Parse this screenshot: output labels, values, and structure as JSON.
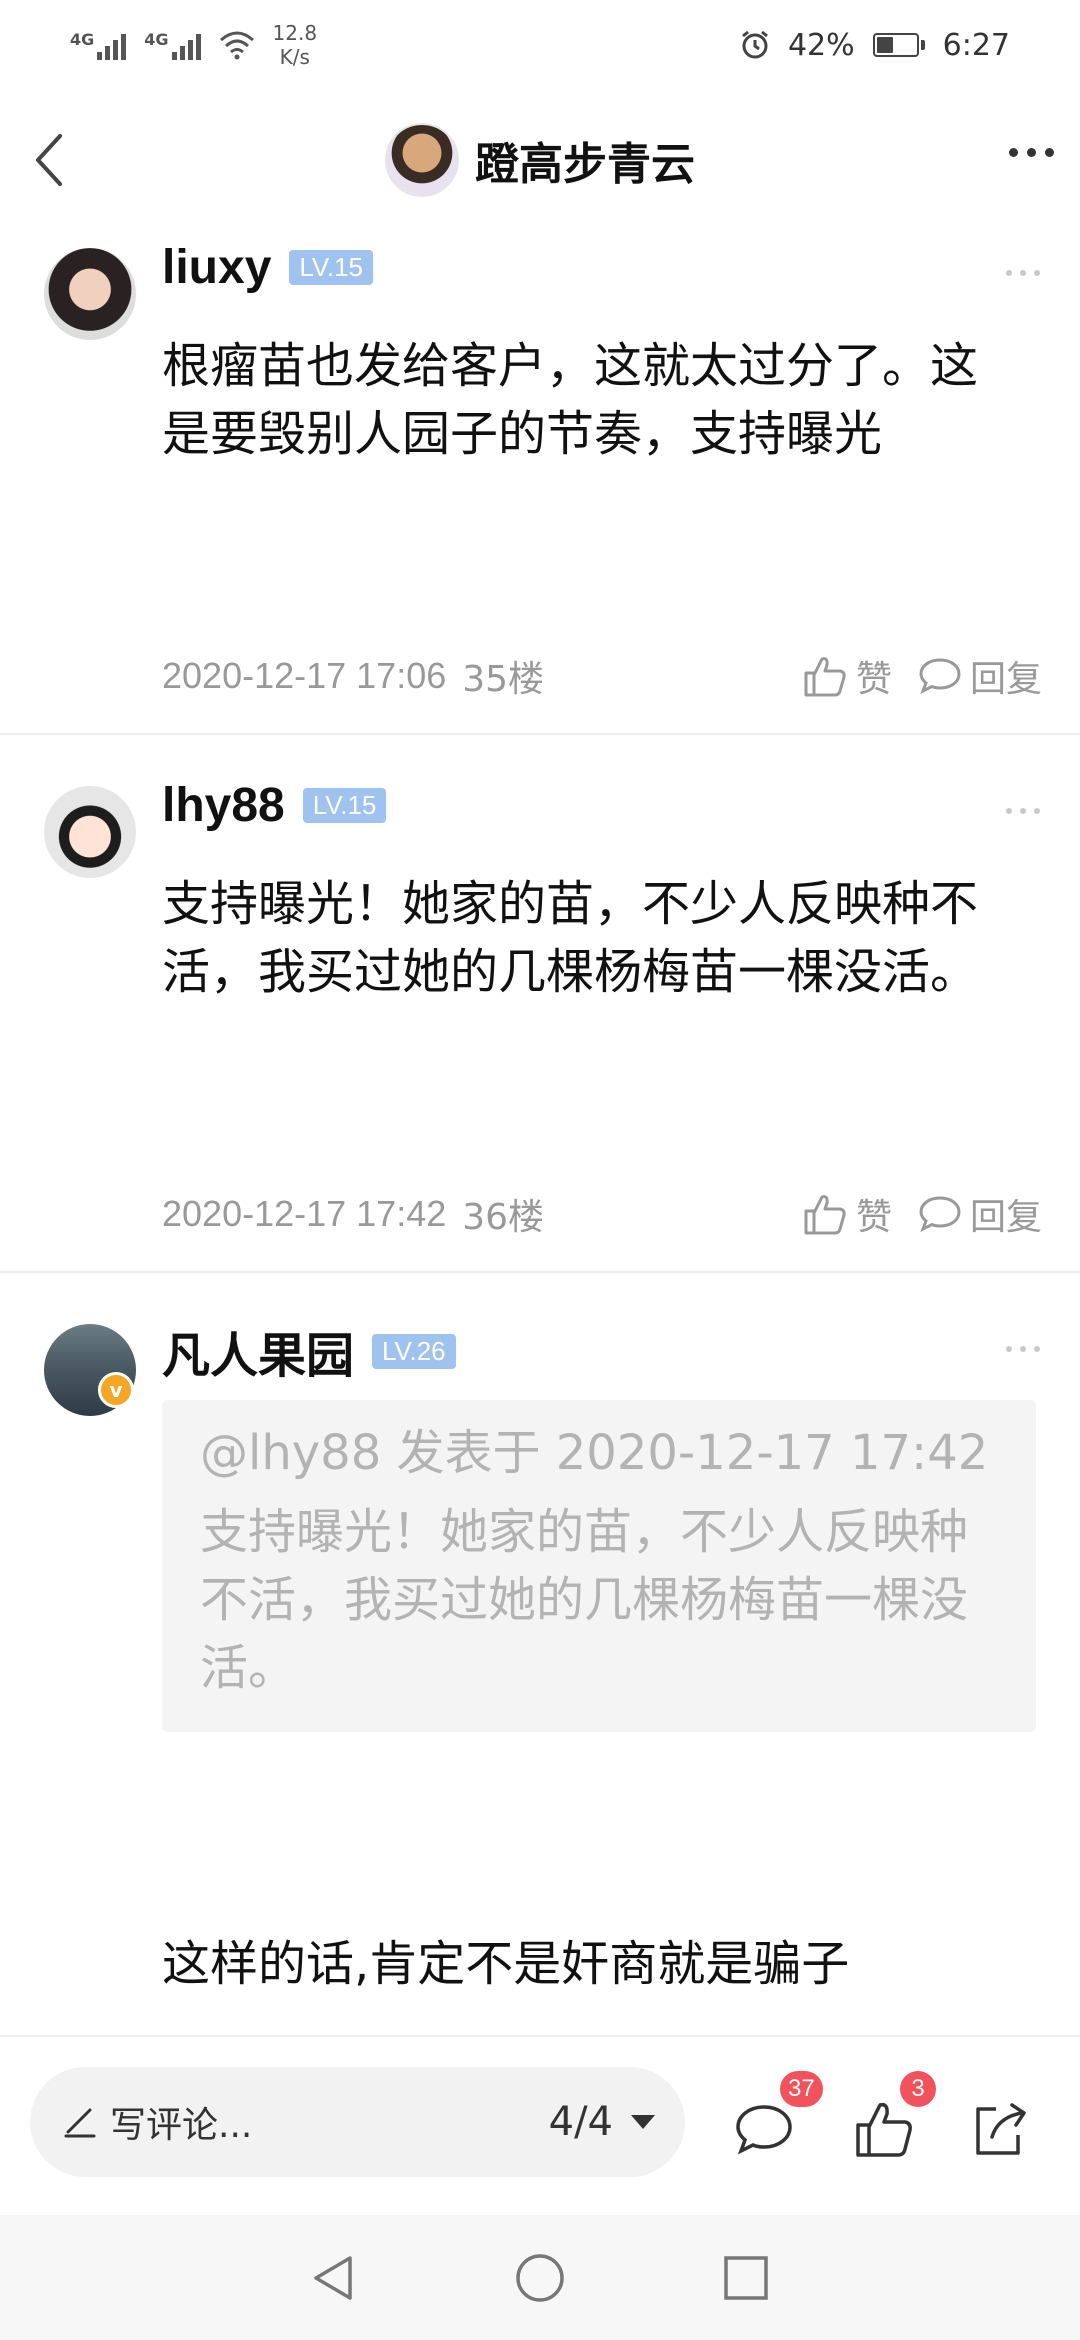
{
  "status_bar": {
    "signal1": "4G",
    "signal2": "4G",
    "net_speed_value": "12.8",
    "net_speed_unit": "K/s",
    "battery": "42%",
    "battery_level": 0.42,
    "time": "6:27"
  },
  "header": {
    "title": "蹬高步青云"
  },
  "comments": [
    {
      "username": "liuxy",
      "level": "LV.15",
      "content": "根瘤苗也发给客户，这就太过分了。这是要毁别人园子的节奏，支持曝光",
      "time": "2020-12-17 17:06",
      "floor": "35楼",
      "like_label": "赞",
      "reply_label": "回复"
    },
    {
      "username": "lhy88",
      "level": "LV.15",
      "content": "支持曝光！她家的苗，不少人反映种不活，我买过她的几棵杨梅苗一棵没活。",
      "time": "2020-12-17 17:42",
      "floor": "36楼",
      "like_label": "赞",
      "reply_label": "回复"
    },
    {
      "username": "凡人果园",
      "level": "LV.26",
      "verified_badge": "v",
      "quote_header": "@lhy88 发表于 2020-12-17 17:42",
      "quote_content": "支持曝光！她家的苗，不少人反映种不活，我买过她的几棵杨梅苗一棵没活。",
      "content": "这样的话,肯定不是奸商就是骗子"
    }
  ],
  "bottom_bar": {
    "input_placeholder": "写评论...",
    "page_indicator": "4/4",
    "comment_count": "37",
    "like_count": "3"
  }
}
